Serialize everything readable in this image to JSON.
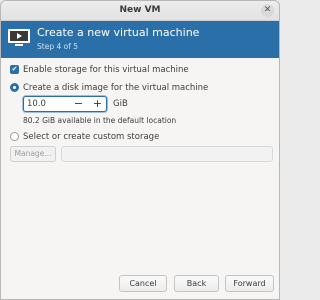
{
  "window": {
    "title": "New VM"
  },
  "header": {
    "title": "Create a new virtual machine",
    "step": "Step 4 of 5"
  },
  "storage": {
    "enable_label": "Enable storage for this virtual machine",
    "enable_checked": true,
    "create_disk_label": "Create a disk image for the virtual machine",
    "disk_size_value": "10.0",
    "disk_size_unit": "GiB",
    "available_text": "80.2 GiB available in the default location",
    "custom_label": "Select or create custom storage",
    "manage_label": "Manage...",
    "custom_path_value": ""
  },
  "buttons": {
    "cancel": "Cancel",
    "back": "Back",
    "forward": "Forward"
  },
  "colors": {
    "banner": "#2b6fa8",
    "accent": "#2b6fa8"
  }
}
